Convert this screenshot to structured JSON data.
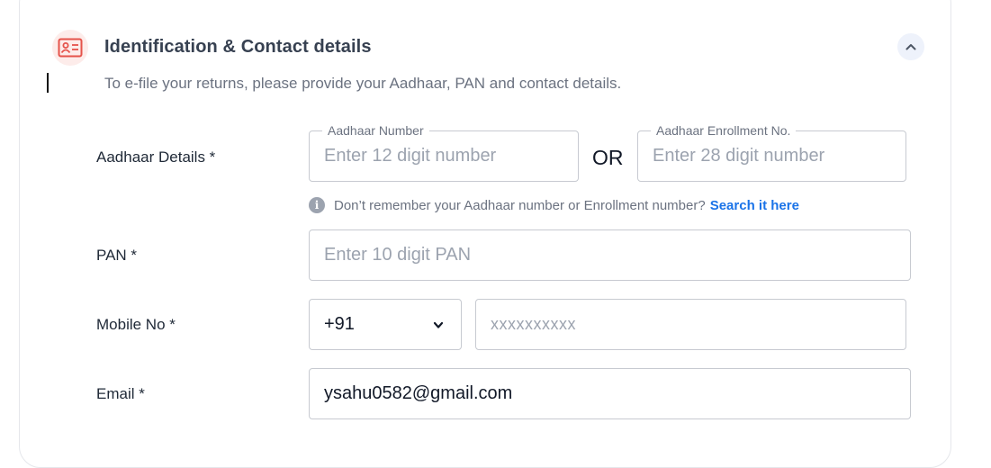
{
  "section": {
    "title": "Identification & Contact details",
    "subtitle": "To e-file your returns, please provide your Aadhaar, PAN and contact details.",
    "icon": "id-card-icon",
    "collapse_icon": "chevron-up-icon",
    "accent_color": "#e5534b"
  },
  "aadhaar": {
    "label": "Aadhaar Details *",
    "number_legend": "Aadhaar Number",
    "number_placeholder": "Enter 12 digit number",
    "or_text": "OR",
    "enrollment_legend": "Aadhaar Enrollment No.",
    "enrollment_placeholder": "Enter 28 digit number",
    "help_text": "Don’t remember your Aadhaar number or Enrollment number?",
    "help_link": "Search it here"
  },
  "pan": {
    "label": "PAN *",
    "placeholder": "Enter 10 digit PAN"
  },
  "mobile": {
    "label": "Mobile No *",
    "country_code": "+91",
    "placeholder": "xxxxxxxxxx"
  },
  "email": {
    "label": "Email *",
    "value": "ysahu0582@gmail.com"
  }
}
